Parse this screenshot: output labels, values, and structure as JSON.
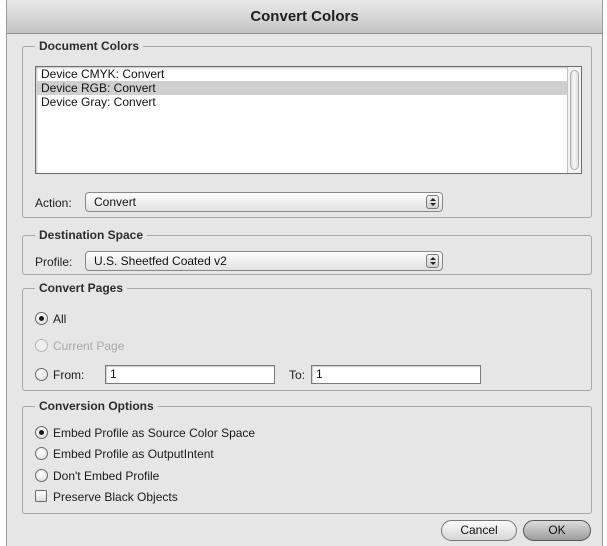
{
  "dialog": {
    "title": "Convert Colors",
    "cancel_label": "Cancel",
    "ok_label": "OK"
  },
  "document_colors": {
    "heading": "Document Colors",
    "items": [
      {
        "label": "Device CMYK: Convert",
        "selected": false
      },
      {
        "label": "Device RGB: Convert",
        "selected": true
      },
      {
        "label": "Device Gray: Convert",
        "selected": false
      }
    ],
    "action_label": "Action:",
    "action_value": "Convert"
  },
  "destination_space": {
    "heading": "Destination Space",
    "profile_label": "Profile:",
    "profile_value": "U.S. Sheetfed Coated v2"
  },
  "convert_pages": {
    "heading": "Convert Pages",
    "all_label": "All",
    "current_page_label": "Current Page",
    "from_label": "From:",
    "from_value": "1",
    "to_label": "To:",
    "to_value": "1",
    "selected": "All"
  },
  "conversion_options": {
    "heading": "Conversion Options",
    "embed_source_label": "Embed Profile as Source Color Space",
    "embed_output_label": "Embed Profile as OutputIntent",
    "dont_embed_label": "Don't Embed Profile",
    "preserve_black_label": "Preserve Black Objects",
    "selected": "Embed Profile as Source Color Space",
    "preserve_black_checked": false
  }
}
